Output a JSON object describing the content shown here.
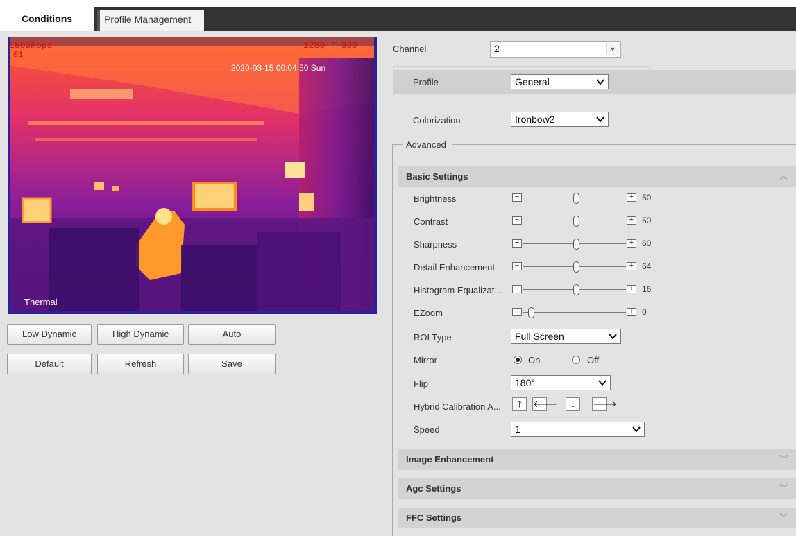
{
  "tabs": [
    {
      "label": "Conditions",
      "active": true
    },
    {
      "label": "Profile Management",
      "active": false
    }
  ],
  "video": {
    "bitrate": "1565Kbps",
    "resolution": "1280 * 960",
    "channel_tag": "01",
    "timestamp": "2020-03-15 00:04:50 Sun",
    "mode_label": "Thermal"
  },
  "buttons": {
    "low_dynamic": "Low Dynamic",
    "high_dynamic": "High Dynamic",
    "auto": "Auto",
    "default": "Default",
    "refresh": "Refresh",
    "save": "Save"
  },
  "form": {
    "channel_label": "Channel",
    "channel_value": "2",
    "profile_label": "Profile",
    "profile_value": "General",
    "colorization_label": "Colorization",
    "colorization_value": "Ironbow2",
    "advanced_label": "Advanced"
  },
  "sections": {
    "basic": "Basic Settings",
    "image_enhancement": "Image Enhancement",
    "agc": "Agc Settings",
    "ffc": "FFC Settings"
  },
  "sliders": [
    {
      "label": "Brightness",
      "value": 50,
      "display": "50"
    },
    {
      "label": "Contrast",
      "value": 50,
      "display": "50"
    },
    {
      "label": "Sharpness",
      "value": 60,
      "display": "60"
    },
    {
      "label": "Detail Enhancement",
      "value": 64,
      "display": "64"
    },
    {
      "label": "Histogram Equalizat...",
      "value": 16,
      "display": "16"
    },
    {
      "label": "EZoom",
      "value": 0,
      "display": "0"
    }
  ],
  "roi": {
    "label": "ROI Type",
    "value": "Full Screen"
  },
  "mirror": {
    "label": "Mirror",
    "on_label": "On",
    "off_label": "Off",
    "selected": "On"
  },
  "flip": {
    "label": "Flip",
    "value": "180°"
  },
  "hybrid": {
    "label": "Hybrid Calibration A...",
    "up": "🡑",
    "left": "🡐",
    "down": "🡓",
    "right": "🡒"
  },
  "speed": {
    "label": "Speed",
    "value": "1"
  },
  "colors": {
    "accent_chevron": "#7ab27a",
    "osd_red": "#cc1111",
    "tab_bar": "#333333"
  }
}
